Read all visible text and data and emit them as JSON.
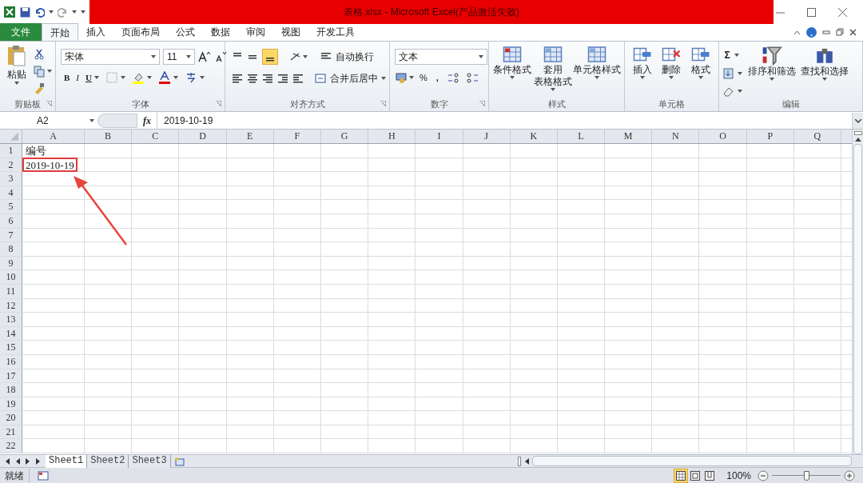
{
  "window": {
    "title": "表格.xlsx  -  Microsoft Excel(产品激活失败)"
  },
  "tabs": [
    {
      "label": "文件",
      "kind": "file",
      "selected": false
    },
    {
      "label": "开始",
      "kind": "tab",
      "selected": true
    },
    {
      "label": "插入",
      "kind": "tab",
      "selected": false
    },
    {
      "label": "页面布局",
      "kind": "tab",
      "selected": false
    },
    {
      "label": "公式",
      "kind": "tab",
      "selected": false
    },
    {
      "label": "数据",
      "kind": "tab",
      "selected": false
    },
    {
      "label": "审阅",
      "kind": "tab",
      "selected": false
    },
    {
      "label": "视图",
      "kind": "tab",
      "selected": false
    },
    {
      "label": "开发工具",
      "kind": "tab",
      "selected": false
    }
  ],
  "ribbon": {
    "clipboard": {
      "label": "剪贴板",
      "paste": "粘贴"
    },
    "font": {
      "label": "字体",
      "name": "宋体",
      "size": "11",
      "bold": "B",
      "italic": "I",
      "underline": "U"
    },
    "alignment": {
      "label": "对齐方式",
      "wrap": "自动换行",
      "merge": "合并后居中",
      "bottom_align_selected": true
    },
    "number": {
      "label": "数字",
      "format": "文本",
      "percent": "%",
      "comma": ","
    },
    "styles": {
      "label": "样式",
      "buttons": [
        [
          "条件格式"
        ],
        [
          "套用",
          "表格格式"
        ],
        [
          "单元格样式"
        ]
      ]
    },
    "cells": {
      "label": "单元格",
      "buttons": [
        "插入",
        "删除",
        "格式"
      ]
    },
    "editing": {
      "label": "编辑",
      "sum": "Σ",
      "buttons": [
        "排序和筛选",
        "查找和选择"
      ]
    }
  },
  "formula_bar": {
    "name_box": "A2",
    "fx": "fx",
    "formula": "2019-10-19"
  },
  "grid": {
    "columns": [
      "A",
      "B",
      "C",
      "D",
      "E",
      "F",
      "G",
      "H",
      "I",
      "J",
      "K",
      "L",
      "M",
      "N",
      "O",
      "P",
      "Q"
    ],
    "rows": [
      {
        "label": "1",
        "cells": [
          {
            "text": "编号",
            "highlighted": false
          }
        ]
      },
      {
        "label": "2",
        "cells": [
          {
            "text": "2019-10-19",
            "highlighted": true
          }
        ]
      },
      {
        "label": "3"
      },
      {
        "label": "4"
      },
      {
        "label": "5"
      },
      {
        "label": "6"
      },
      {
        "label": "7"
      },
      {
        "label": "8"
      },
      {
        "label": "9"
      },
      {
        "label": "10"
      },
      {
        "label": "11"
      },
      {
        "label": "12"
      },
      {
        "label": "13"
      },
      {
        "label": "14"
      },
      {
        "label": "15"
      },
      {
        "label": "16"
      },
      {
        "label": "17"
      },
      {
        "label": "18"
      },
      {
        "label": "19"
      },
      {
        "label": "20"
      },
      {
        "label": "21"
      },
      {
        "label": "22"
      }
    ]
  },
  "sheet_tabs": [
    {
      "label": "Sheet1",
      "selected": true
    },
    {
      "label": "Sheet2",
      "selected": false
    },
    {
      "label": "Sheet3",
      "selected": false
    }
  ],
  "status_bar": {
    "status": "就绪",
    "views": [
      {
        "kind": "normal",
        "selected": true
      },
      {
        "kind": "layout",
        "selected": false
      },
      {
        "kind": "pagebreak",
        "selected": false
      }
    ],
    "zoom": "100%",
    "zoom_slider": {
      "level": 0.5
    }
  }
}
